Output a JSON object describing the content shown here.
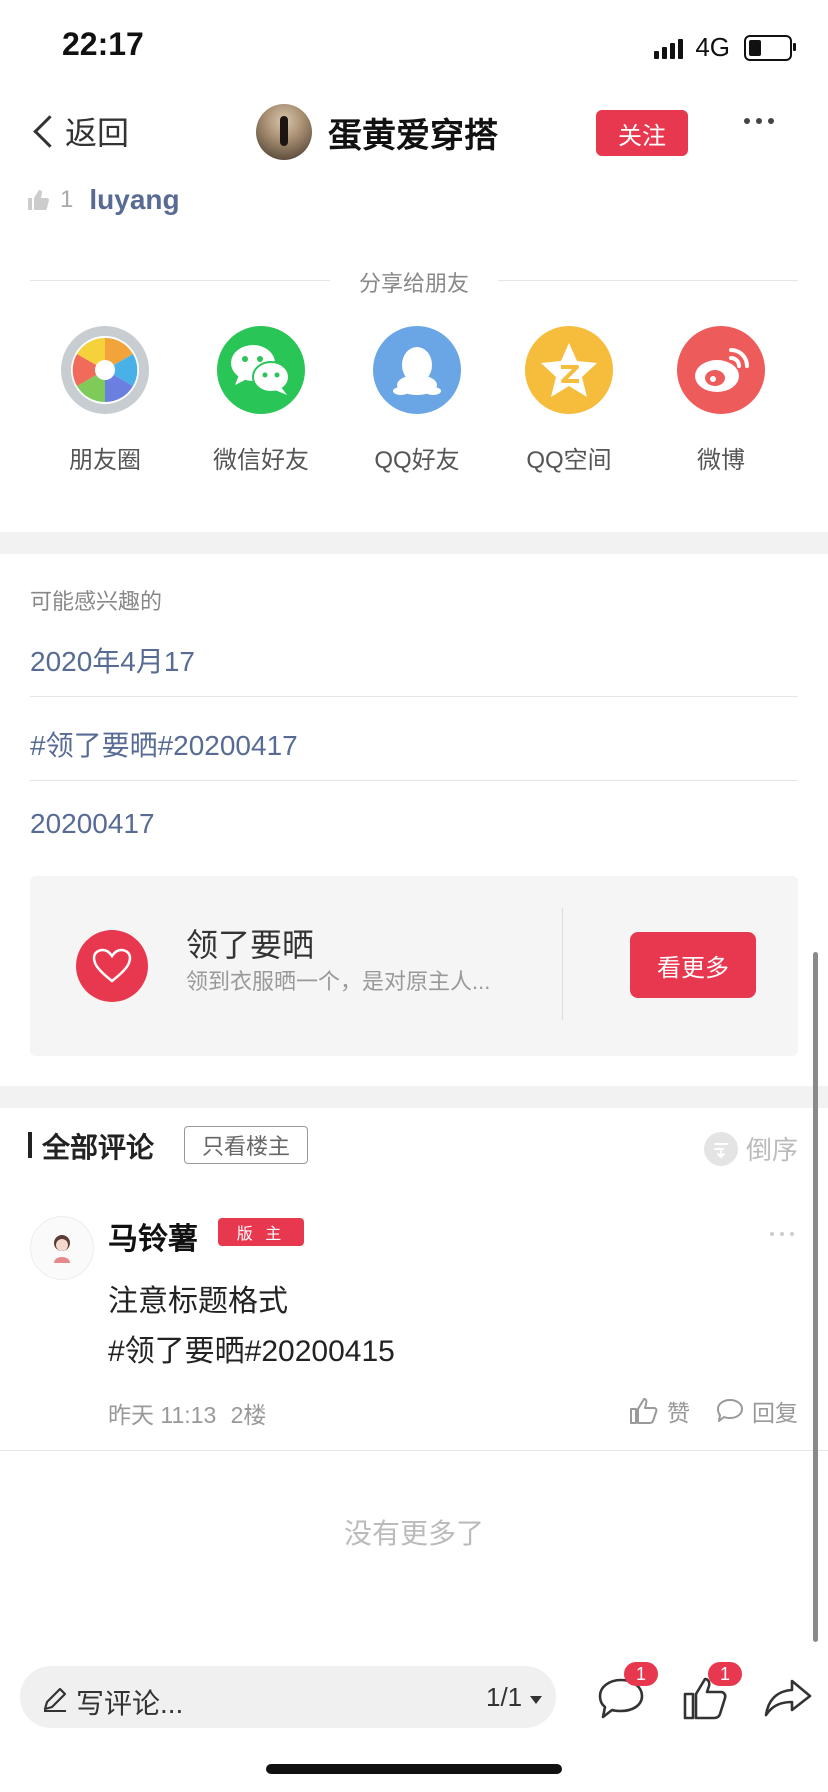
{
  "status_bar": {
    "time": "22:17",
    "network": "4G",
    "battery_level": 0.3
  },
  "nav": {
    "back_label": "返回",
    "title": "蛋黄爱穿搭",
    "follow_label": "关注"
  },
  "likes": {
    "count": "1",
    "user": "luyang"
  },
  "share": {
    "label": "分享给朋友",
    "targets": [
      {
        "label": "朋友圈",
        "icon": "moments-icon",
        "color": "#c8cdd2"
      },
      {
        "label": "微信好友",
        "icon": "wechat-icon",
        "color": "#29c556"
      },
      {
        "label": "QQ好友",
        "icon": "qq-icon",
        "color": "#6aa6e6"
      },
      {
        "label": "QQ空间",
        "icon": "qzone-icon",
        "color": "#f6bc3c"
      },
      {
        "label": "微博",
        "icon": "weibo-icon",
        "color": "#ee5b5b"
      }
    ]
  },
  "interest": {
    "label": "可能感兴趣的",
    "items": [
      "2020年4月17",
      "#领了要晒#20200417",
      "20200417"
    ]
  },
  "topic": {
    "title": "领了要晒",
    "desc": "领到衣服晒一个，是对原主人...",
    "button": "看更多"
  },
  "comments": {
    "title": "全部评论",
    "owner_only": "只看楼主",
    "sort_label": "倒序",
    "items": [
      {
        "name": "马铃薯",
        "badge": "版 主",
        "lines": [
          "注意标题格式",
          "#领了要晒#20200415"
        ],
        "time": "昨天 11:13",
        "floor": "2楼",
        "like_label": "赞",
        "reply_label": "回复"
      }
    ],
    "no_more": "没有更多了"
  },
  "bottom_bar": {
    "placeholder": "写评论...",
    "page": "1/1",
    "comment_badge": "1",
    "like_badge": "1"
  },
  "colors": {
    "accent": "#e8384f",
    "link": "#576b95"
  }
}
